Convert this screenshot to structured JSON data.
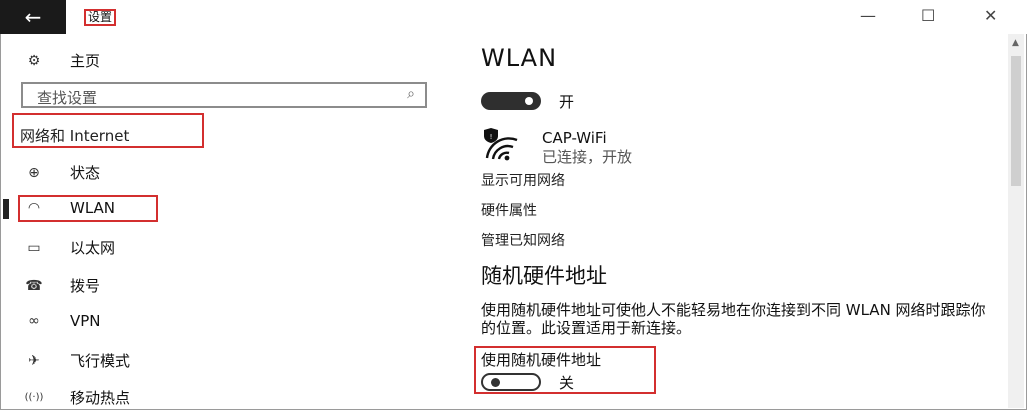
{
  "window": {
    "title": "设置",
    "back_glyph": "←",
    "minimize_glyph": "—",
    "maximize_glyph": "☐",
    "close_glyph": "✕"
  },
  "sidebar": {
    "home_label": "主页",
    "search": {
      "placeholder": "查找设置"
    },
    "section_title": "网络和 Internet",
    "items": [
      {
        "label": "状态",
        "icon": "globe-icon",
        "glyph": "⊕"
      },
      {
        "label": "WLAN",
        "icon": "wifi-icon",
        "glyph": "◠"
      },
      {
        "label": "以太网",
        "icon": "ethernet-icon",
        "glyph": "▭"
      },
      {
        "label": "拨号",
        "icon": "dialup-icon",
        "glyph": "☎"
      },
      {
        "label": "VPN",
        "icon": "vpn-icon",
        "glyph": "∞"
      },
      {
        "label": "飞行模式",
        "icon": "airplane-icon",
        "glyph": "✈"
      },
      {
        "label": "移动热点",
        "icon": "hotspot-icon",
        "glyph": "((·))"
      }
    ],
    "active_item": "WLAN"
  },
  "main": {
    "title": "WLAN",
    "wlan_toggle": {
      "state_label": "开",
      "on": true
    },
    "network": {
      "name": "CAP-WiFi",
      "status": "已连接，开放"
    },
    "links": [
      "显示可用网络",
      "硬件属性",
      "管理已知网络"
    ],
    "random_hw": {
      "heading": "随机硬件地址",
      "description": "使用随机硬件地址可使他人不能轻易地在你连接到不同 WLAN 网络时跟踪你的位置。此设置适用于新连接。",
      "toggle_label": "使用随机硬件地址",
      "toggle_state": "关",
      "on": false
    }
  },
  "colors": {
    "highlight_box": "#d32f2f",
    "toggle_dark": "#2f2f2f"
  }
}
